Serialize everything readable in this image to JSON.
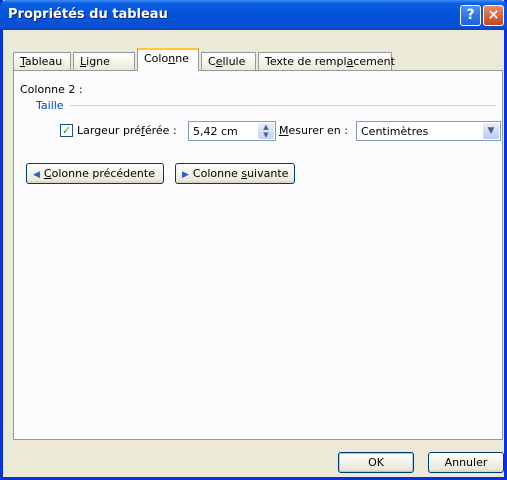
{
  "window": {
    "title": "Propriétés du tableau",
    "help_icon": "?",
    "close_icon": "×"
  },
  "tabs": [
    {
      "pre": "",
      "u": "T",
      "post": "ableau"
    },
    {
      "pre": "",
      "u": "L",
      "post": "igne"
    },
    {
      "pre": "Colo",
      "u": "n",
      "post": "ne"
    },
    {
      "pre": "C",
      "u": "e",
      "post": "llule"
    },
    {
      "pre": "Texte de rempl",
      "u": "a",
      "post": "cement"
    }
  ],
  "panel": {
    "column_label": "Colonne 2 :",
    "section": "Taille",
    "checkbox_mark": "✓",
    "preferred_pre": "Largeur pré",
    "preferred_u": "f",
    "preferred_post": "érée :",
    "width_value": "5,42 cm",
    "measure_u": "M",
    "measure_post": "esurer en :",
    "measure_value": "Centimètres",
    "prev_u": "C",
    "prev_post": "olonne précédente",
    "next_pre": "Colonne ",
    "next_u": "s",
    "next_post": "uivante"
  },
  "footer": {
    "ok": "OK",
    "cancel": "Annuler"
  }
}
